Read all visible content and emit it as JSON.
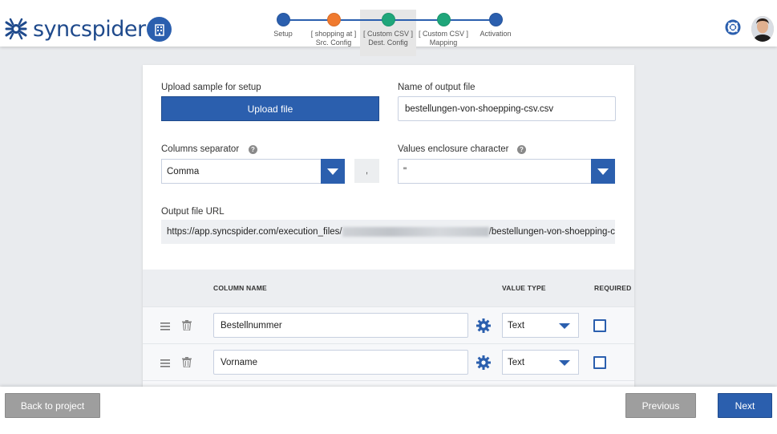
{
  "brand": {
    "name": "syncspider",
    "color": "#1f4a8c",
    "accent": "#2b5fae"
  },
  "stepper": {
    "steps": [
      {
        "label": "Setup",
        "color": "#2b5fae"
      },
      {
        "label": "[ shopping at ]\nSrc. Config",
        "color": "#f07a2e"
      },
      {
        "label": "[ Custom CSV ]\nDest. Config",
        "color": "#1fa67a",
        "active": true
      },
      {
        "label": "[ Custom CSV ]\nMapping",
        "color": "#1fa67a"
      },
      {
        "label": "Activation",
        "color": "#2b5fae"
      }
    ]
  },
  "form": {
    "upload_label": "Upload sample for setup",
    "upload_button": "Upload file",
    "output_name_label": "Name of output file",
    "output_name_value": "bestellungen-von-shoepping-csv.csv",
    "separator_label": "Columns separator",
    "separator_value": "Comma",
    "separator_preview": ",",
    "enclosure_label": "Values enclosure character",
    "enclosure_value": "\"",
    "url_label": "Output file URL",
    "url_prefix": "https://app.syncspider.com/execution_files/",
    "url_suffix": "/bestellungen-von-shoepping-c"
  },
  "table": {
    "headers": {
      "column_name": "COLUMN NAME",
      "value_type": "VALUE TYPE",
      "required": "REQUIRED"
    },
    "rows": [
      {
        "name": "Bestellnummer",
        "type": "Text",
        "required": false
      },
      {
        "name": "Vorname",
        "type": "Text",
        "required": false
      }
    ]
  },
  "footer": {
    "back": "Back to project",
    "previous": "Previous",
    "next": "Next"
  }
}
